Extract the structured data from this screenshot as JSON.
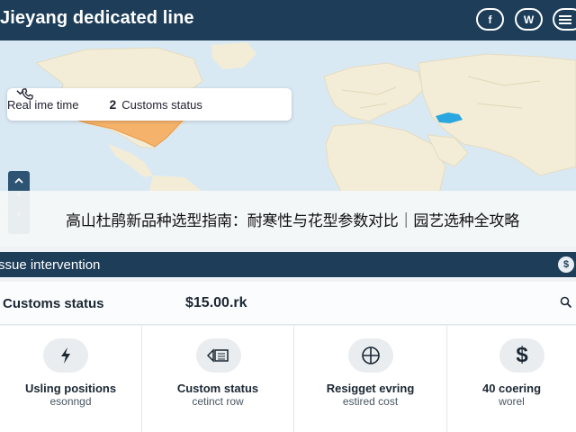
{
  "header": {
    "title": "Jieyang dedicated line",
    "buttons": [
      {
        "name": "facebook-icon",
        "label": "f"
      },
      {
        "name": "w-icon",
        "label": "W"
      },
      {
        "name": "menu-icon",
        "label": ""
      }
    ]
  },
  "map": {
    "filter_bar": {
      "item1": "Real ime time",
      "item2_number": "2",
      "item2_label": "Customs status"
    },
    "highlight_color": "#f5b26b",
    "marker_color": "#2aa7e0"
  },
  "banner": {
    "text": "高山杜鹃新品种选型指南：耐寒性与花型参数对比｜园艺选种全攻略"
  },
  "section": {
    "title": "ssue intervention"
  },
  "status_row": {
    "label": "Customs status",
    "value": "$15.00.rk"
  },
  "cards": [
    {
      "icon": "lightning-icon",
      "title": "Usling positions",
      "subtitle": "esonngd"
    },
    {
      "icon": "document-icon",
      "title": "Custom status",
      "subtitle": "cetinct row"
    },
    {
      "icon": "crosshair-icon",
      "title": "Resigget evring",
      "subtitle": "estired cost"
    },
    {
      "icon": "dollar-icon",
      "title": "40 coering",
      "subtitle": "worel"
    }
  ],
  "colors": {
    "header_bg": "#1d3d58",
    "map_water": "#d9e9f4",
    "map_land": "#f3ecd6"
  }
}
